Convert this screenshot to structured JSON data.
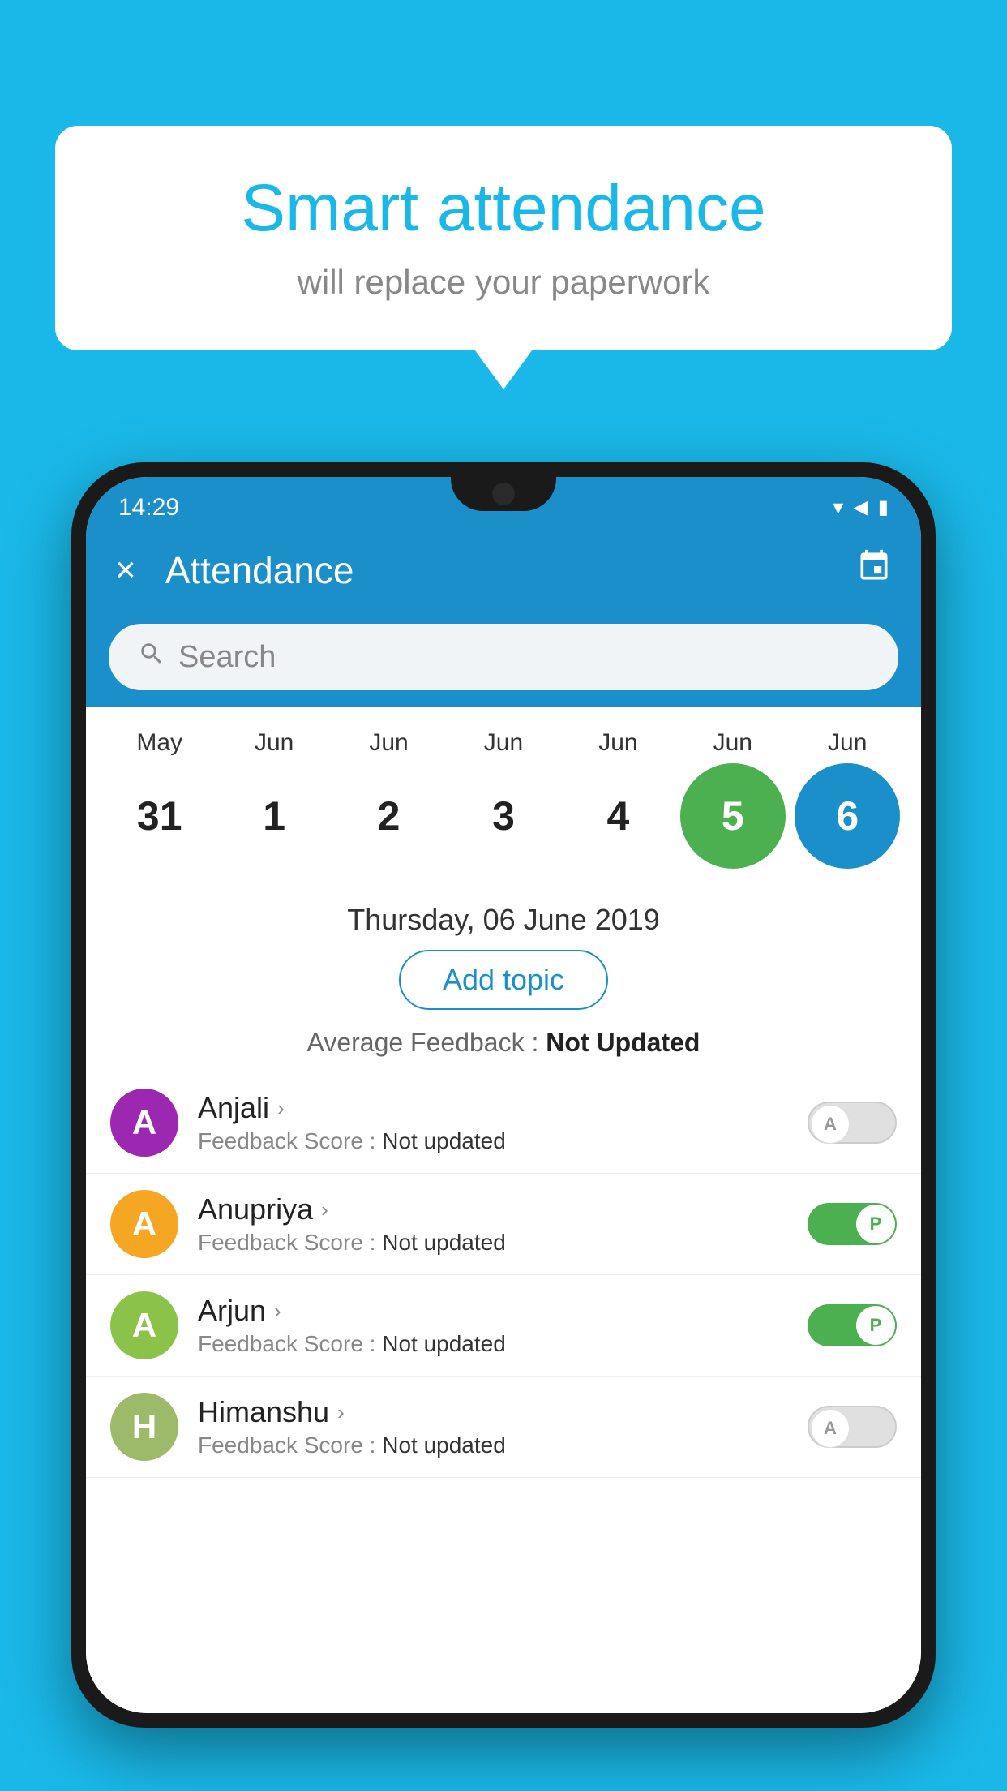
{
  "background_color": "#1ab8e8",
  "speech_bubble": {
    "title": "Smart attendance",
    "subtitle": "will replace your paperwork"
  },
  "status_bar": {
    "time": "14:29",
    "wifi": "▼",
    "signal": "◀",
    "battery": "▮"
  },
  "app_bar": {
    "title": "Attendance",
    "close_label": "×",
    "calendar_icon": "📅"
  },
  "search": {
    "placeholder": "Search"
  },
  "calendar": {
    "days": [
      {
        "month": "May",
        "date": "31",
        "state": "normal"
      },
      {
        "month": "Jun",
        "date": "1",
        "state": "normal"
      },
      {
        "month": "Jun",
        "date": "2",
        "state": "normal"
      },
      {
        "month": "Jun",
        "date": "3",
        "state": "normal"
      },
      {
        "month": "Jun",
        "date": "4",
        "state": "normal"
      },
      {
        "month": "Jun",
        "date": "5",
        "state": "today"
      },
      {
        "month": "Jun",
        "date": "6",
        "state": "selected"
      }
    ]
  },
  "selected_date_label": "Thursday, 06 June 2019",
  "add_topic_label": "Add topic",
  "avg_feedback_label": "Average Feedback :",
  "avg_feedback_value": "Not Updated",
  "students": [
    {
      "name": "Anjali",
      "avatar_letter": "A",
      "avatar_color": "#9c27b0",
      "feedback_label": "Feedback Score :",
      "feedback_value": "Not updated",
      "toggle_state": "off",
      "toggle_label": "A"
    },
    {
      "name": "Anupriya",
      "avatar_letter": "A",
      "avatar_color": "#f5a623",
      "feedback_label": "Feedback Score :",
      "feedback_value": "Not updated",
      "toggle_state": "on",
      "toggle_label": "P"
    },
    {
      "name": "Arjun",
      "avatar_letter": "A",
      "avatar_color": "#8bc34a",
      "feedback_label": "Feedback Score :",
      "feedback_value": "Not updated",
      "toggle_state": "on",
      "toggle_label": "P"
    },
    {
      "name": "Himanshu",
      "avatar_letter": "H",
      "avatar_color": "#9cba6a",
      "feedback_label": "Feedback Score :",
      "feedback_value": "Not updated",
      "toggle_state": "off",
      "toggle_label": "A"
    }
  ]
}
